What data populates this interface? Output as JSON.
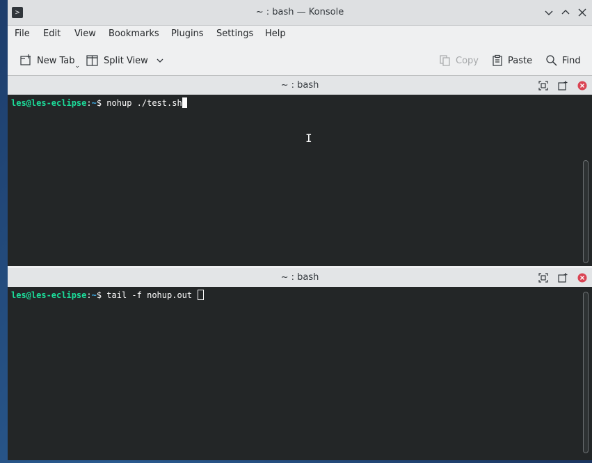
{
  "window": {
    "title": "~ : bash — Konsole",
    "app_icon": "terminal-icon"
  },
  "menu": [
    "File",
    "Edit",
    "View",
    "Bookmarks",
    "Plugins",
    "Settings",
    "Help"
  ],
  "toolbar": {
    "new_tab": "New Tab",
    "split_view": "Split View",
    "copy": "Copy",
    "paste": "Paste",
    "find": "Find"
  },
  "panes": [
    {
      "title": "~ : bash",
      "user_host": "les@les-eclipse",
      "sep": ":",
      "path": "~",
      "dollar": "$",
      "command": " nohup ./test.sh"
    },
    {
      "title": "~ : bash",
      "user_host": "les@les-eclipse",
      "sep": ":",
      "path": "~",
      "dollar": "$",
      "command": " tail -f nohup.out "
    }
  ],
  "colors": {
    "terminal_bg": "#232627",
    "prompt_user": "#1cdc9a",
    "prompt_path": "#3daee9",
    "close_red": "#da4453"
  }
}
